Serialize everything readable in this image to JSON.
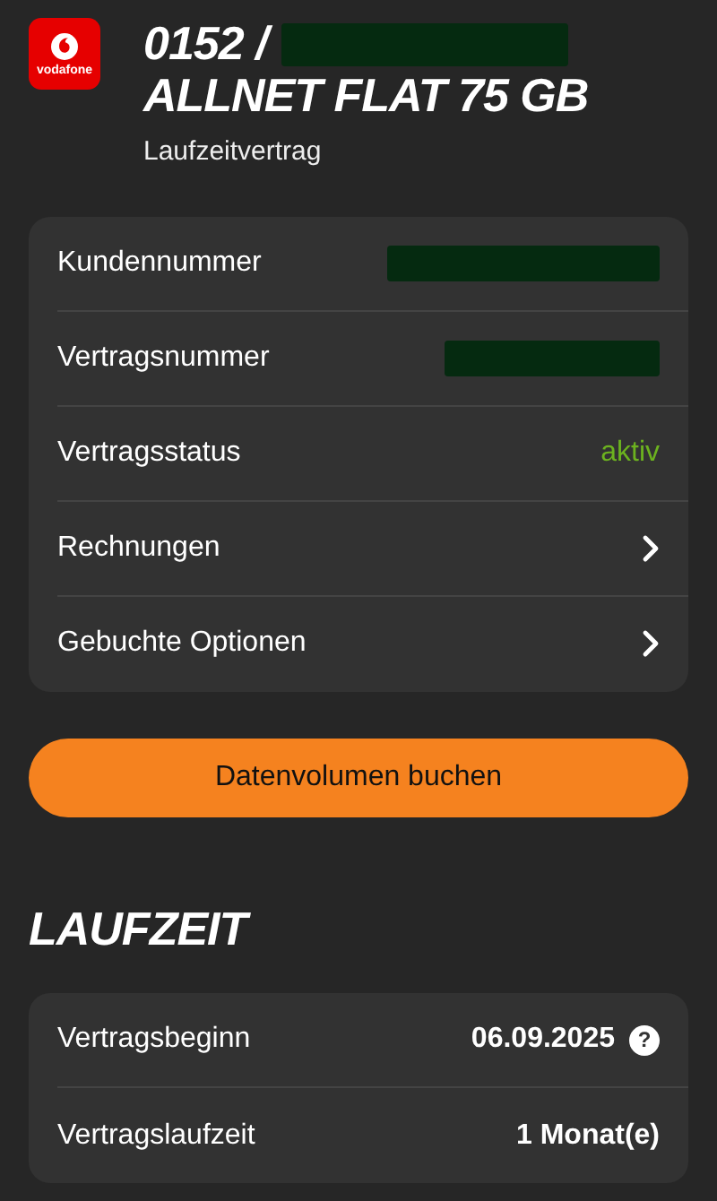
{
  "header": {
    "logo_text": "vodafone",
    "number_prefix": "0152 /",
    "number_redacted": true,
    "tariff": "ALLNET FLAT 75 GB",
    "contract_type": "Laufzeitvertrag"
  },
  "details": [
    {
      "kind": "redacted",
      "label": "Kundennummer"
    },
    {
      "kind": "redacted",
      "label": "Vertragsnummer"
    },
    {
      "kind": "status",
      "label": "Vertragsstatus",
      "value": "aktiv",
      "color": "#6cb21f"
    },
    {
      "kind": "link",
      "label": "Rechnungen"
    },
    {
      "kind": "link",
      "label": "Gebuchte Optionen"
    }
  ],
  "action_button": "Datenvolumen buchen",
  "term": {
    "heading": "LAUFZEIT",
    "rows": [
      {
        "kind": "help",
        "label": "Vertragsbeginn",
        "value": "06.09.2025",
        "help": "?"
      },
      {
        "kind": "value",
        "label": "Vertragslaufzeit",
        "value": "1 Monat(e)"
      }
    ]
  }
}
